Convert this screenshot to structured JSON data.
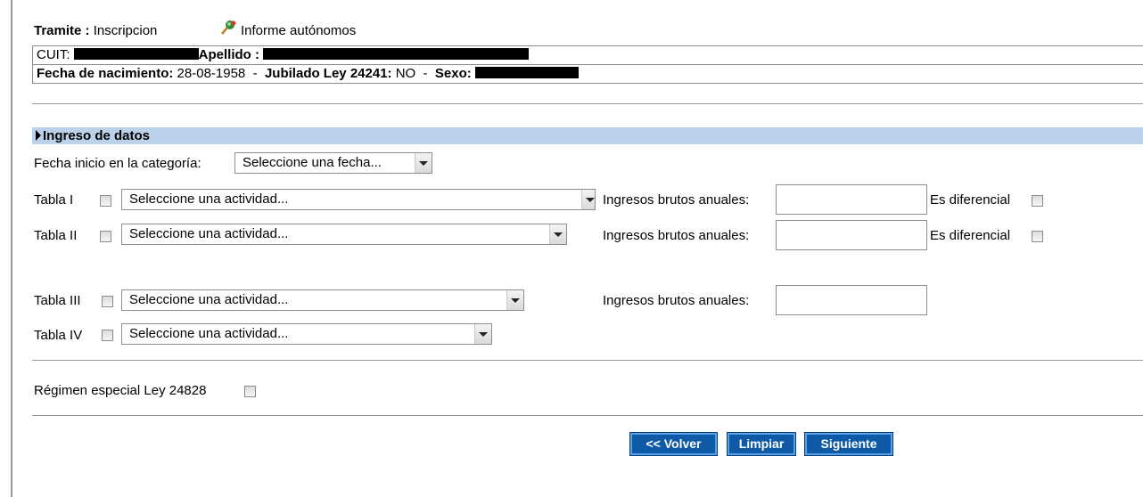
{
  "header": {
    "tramite_label": "Tramite :",
    "tramite_value": "Inscripcion",
    "informe_link": "Informe autónomos",
    "informe_icon": "map-pin-icon"
  },
  "info": {
    "cuit_label": "CUIT:",
    "apellido_label": "Apellido :",
    "fecha_nac_label": "Fecha de nacimiento:",
    "fecha_nac_value": "28-08-1958",
    "sep": "-",
    "jubilado_label": "Jubilado Ley 24241:",
    "jubilado_value": "NO",
    "sexo_label": "Sexo:"
  },
  "section": {
    "title": "Ingreso de datos"
  },
  "form": {
    "fecha_inicio_label": "Fecha inicio en la categoría:",
    "fecha_inicio_value": "Seleccione una fecha...",
    "rows": [
      {
        "label": "Tabla I",
        "select": "Seleccione una actividad...",
        "ingresos_label": "Ingresos brutos anuales:",
        "diferencial_label": "Es diferencial"
      },
      {
        "label": "Tabla II",
        "select": "Seleccione una actividad...",
        "ingresos_label": "Ingresos brutos anuales:",
        "diferencial_label": "Es diferencial"
      },
      {
        "label": "Tabla III",
        "select": "Seleccione una actividad...",
        "ingresos_label": "Ingresos brutos anuales:"
      },
      {
        "label": "Tabla IV",
        "select": "Seleccione una actividad..."
      }
    ],
    "regimen_label": "Régimen especial Ley 24828"
  },
  "buttons": {
    "volver": "<< Volver",
    "limpiar": "Limpiar",
    "siguiente": "Siguiente"
  },
  "colors": {
    "section_bar": "#bcd2ea",
    "button_bg": "#0e5aa6"
  }
}
